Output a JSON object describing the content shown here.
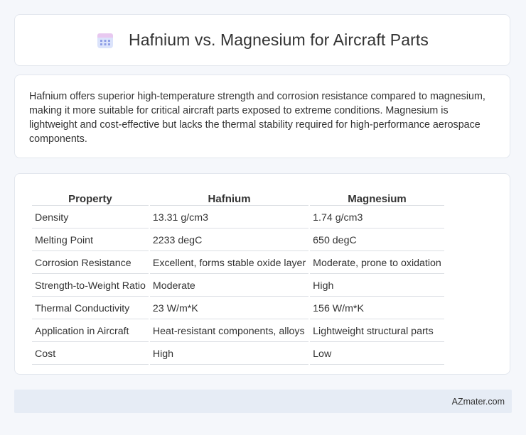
{
  "header": {
    "title": "Hafnium vs. Magnesium for Aircraft Parts",
    "icon": "calendar-icon"
  },
  "summary": {
    "text": "Hafnium offers superior high-temperature strength and corrosion resistance compared to magnesium, making it more suitable for critical aircraft parts exposed to extreme conditions. Magnesium is lightweight and cost-effective but lacks the thermal stability required for high-performance aerospace components."
  },
  "table": {
    "headers": [
      "Property",
      "Hafnium",
      "Magnesium"
    ],
    "rows": [
      [
        "Density",
        "13.31 g/cm3",
        "1.74 g/cm3"
      ],
      [
        "Melting Point",
        "2233 degC",
        "650 degC"
      ],
      [
        "Corrosion Resistance",
        "Excellent, forms stable oxide layer",
        "Moderate, prone to oxidation"
      ],
      [
        "Strength-to-Weight Ratio",
        "Moderate",
        "High"
      ],
      [
        "Thermal Conductivity",
        "23 W/m*K",
        "156 W/m*K"
      ],
      [
        "Application in Aircraft",
        "Heat-resistant components, alloys",
        "Lightweight structural parts"
      ],
      [
        "Cost",
        "High",
        "Low"
      ]
    ]
  },
  "footer": {
    "text": "AZmater.com"
  },
  "colors": {
    "background": "#f5f7fb",
    "card": "#ffffff",
    "footer_bg": "#e6ecf5",
    "icon_top": "#e8c8f0",
    "icon_body": "#dbe3fb",
    "icon_dots": "#8e9ee6"
  }
}
